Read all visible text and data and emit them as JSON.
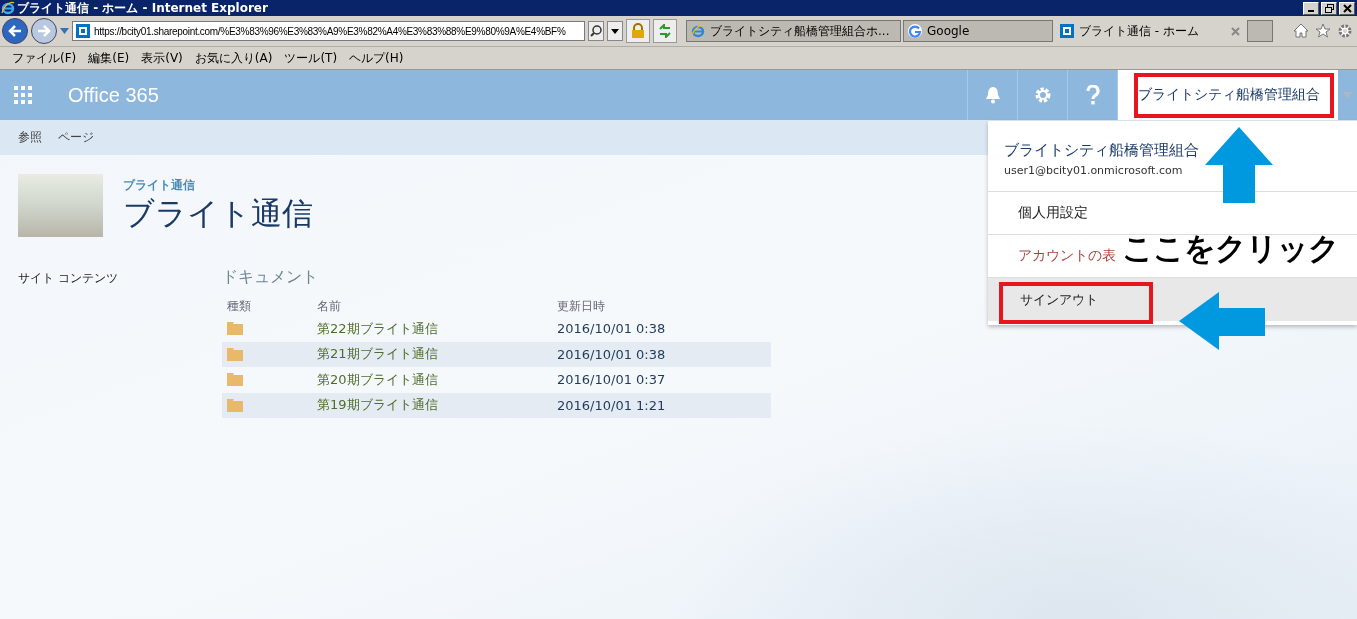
{
  "window": {
    "title": "ブライト通信 - ホーム - Internet Explorer"
  },
  "address_bar": {
    "url": "https://bcity01.sharepoint.com/%E3%83%96%E3%83%A9%E3%82%A4%E3%83%88%E9%80%9A%E4%BF%"
  },
  "tabs": [
    {
      "label": "ブライトシティ船橋管理組合ホ...",
      "kind": "ie",
      "selected": false
    },
    {
      "label": "Google",
      "kind": "google",
      "selected": false
    },
    {
      "label": "ブライト通信 - ホーム",
      "kind": "sharepoint",
      "selected": true
    }
  ],
  "menu_bar": [
    "ファイル(F)",
    "編集(E)",
    "表示(V)",
    "お気に入り(A)",
    "ツール(T)",
    "ヘルプ(H)"
  ],
  "suite_bar": {
    "brand": "Office 365",
    "user": "ブライトシティ船橋管理組合"
  },
  "ribbon_tabs": [
    "参照",
    "ページ"
  ],
  "site": {
    "breadcrumb": "ブライト通信",
    "title": "ブライト通信"
  },
  "nav": [
    "サイト コンテンツ"
  ],
  "library": {
    "title": "ドキュメント",
    "columns": [
      "種類",
      "名前",
      "更新日時"
    ],
    "rows": [
      {
        "name": "第22期ブライト通信",
        "modified": "2016/10/01 0:38"
      },
      {
        "name": "第21期ブライト通信",
        "modified": "2016/10/01 0:38"
      },
      {
        "name": "第20期ブライト通信",
        "modified": "2016/10/01 0:37"
      },
      {
        "name": "第19期ブライト通信",
        "modified": "2016/10/01 1:21"
      }
    ]
  },
  "account_menu": {
    "name": "ブライトシティ船橋管理組合",
    "email": "user1@bcity01.onmicrosoft.com",
    "items": [
      {
        "label": "個人用設定",
        "kind": "normal",
        "selected": false
      },
      {
        "label": "アカウントの表",
        "kind": "link",
        "selected": false
      },
      {
        "label": "サインアウト",
        "kind": "normal",
        "selected": true
      }
    ]
  },
  "annotation": {
    "text": "ここをクリック"
  }
}
